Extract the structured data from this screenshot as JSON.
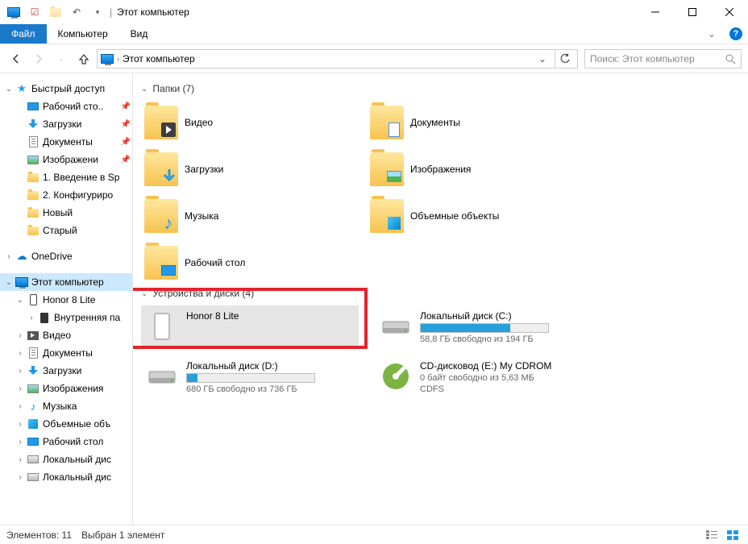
{
  "titlebar": {
    "title": "Этот компьютер"
  },
  "ribbon": {
    "file": "Файл",
    "tabs": [
      "Компьютер",
      "Вид"
    ]
  },
  "address": {
    "crumb": "Этот компьютер",
    "search_placeholder": "Поиск: Этот компьютер"
  },
  "sidebar": {
    "quick_access": "Быстрый доступ",
    "quick_items": [
      {
        "label": "Рабочий сто..",
        "icon": "desktop",
        "pinned": true
      },
      {
        "label": "Загрузки",
        "icon": "download",
        "pinned": true
      },
      {
        "label": "Документы",
        "icon": "doc",
        "pinned": true
      },
      {
        "label": "Изображени",
        "icon": "pic",
        "pinned": true
      },
      {
        "label": "1. Введение в Sp",
        "icon": "folder",
        "pinned": false
      },
      {
        "label": "2. Конфигуриро",
        "icon": "folder",
        "pinned": false
      },
      {
        "label": "Новый",
        "icon": "folder",
        "pinned": false
      },
      {
        "label": "Старый",
        "icon": "folder",
        "pinned": false
      }
    ],
    "onedrive": "OneDrive",
    "this_pc": "Этот компьютер",
    "phone": "Honor 8 Lite",
    "phone_storage": "Внутренняя па",
    "pc_items": [
      {
        "label": "Видео",
        "icon": "video"
      },
      {
        "label": "Документы",
        "icon": "doc"
      },
      {
        "label": "Загрузки",
        "icon": "download"
      },
      {
        "label": "Изображения",
        "icon": "pic"
      },
      {
        "label": "Музыка",
        "icon": "music"
      },
      {
        "label": "Объемные объ",
        "icon": "obj"
      },
      {
        "label": "Рабочий стол",
        "icon": "desktop"
      },
      {
        "label": "Локальный дис",
        "icon": "hdd"
      },
      {
        "label": "Локальный дис",
        "icon": "hdd"
      }
    ]
  },
  "content": {
    "folders_header": "Папки (7)",
    "folders": [
      {
        "label": "Видео",
        "overlay": "video"
      },
      {
        "label": "Документы",
        "overlay": "doc"
      },
      {
        "label": "Загрузки",
        "overlay": "download"
      },
      {
        "label": "Изображения",
        "overlay": "pic"
      },
      {
        "label": "Музыка",
        "overlay": "music"
      },
      {
        "label": "Объемные объекты",
        "overlay": "obj"
      },
      {
        "label": "Рабочий стол",
        "overlay": "desktop"
      }
    ],
    "drives_header": "Устройства и диски (4)",
    "drives": [
      {
        "name": "Honor 8 Lite",
        "type": "phone",
        "selected": true
      },
      {
        "name": "Локальный диск (C:)",
        "type": "hdd",
        "bar_pct": 70,
        "sub": "58,8 ГБ свободно из 194 ГБ"
      },
      {
        "name": "Локальный диск (D:)",
        "type": "hdd",
        "bar_pct": 8,
        "sub": "680 ГБ свободно из 736 ГБ"
      },
      {
        "name": "CD-дисковод (E:) My CDROM",
        "type": "cd",
        "sub": "0 байт свободно из 5,63 МБ",
        "sub2": "CDFS"
      }
    ]
  },
  "statusbar": {
    "count": "Элементов: 11",
    "selected": "Выбран 1 элемент"
  }
}
